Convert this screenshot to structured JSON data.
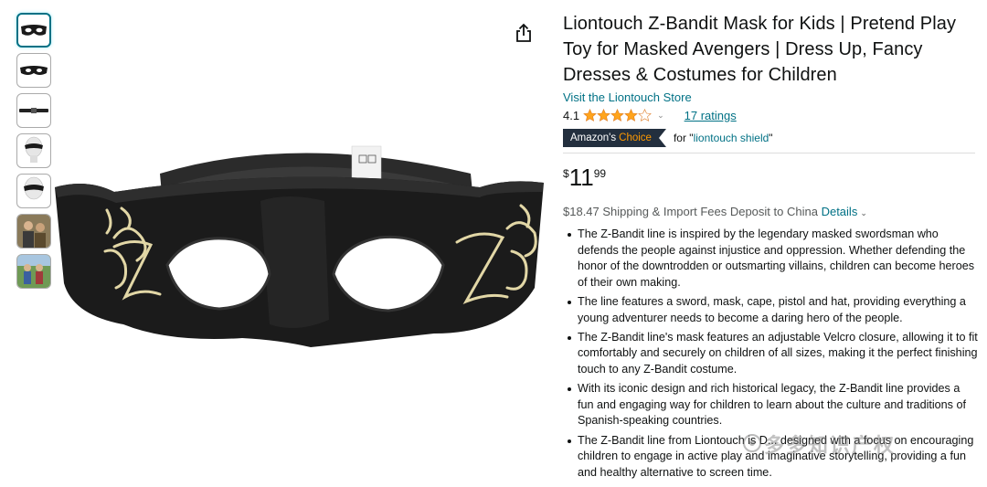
{
  "thumbnails": [
    {
      "icon": "mask-front-thumb"
    },
    {
      "icon": "mask-flat-thumb"
    },
    {
      "icon": "mask-strap-thumb"
    },
    {
      "icon": "mannequin-thumb"
    },
    {
      "icon": "mannequin-side-thumb"
    },
    {
      "icon": "kids-photo-thumb"
    },
    {
      "icon": "kids-outdoor-thumb"
    }
  ],
  "product": {
    "title": "Liontouch Z-Bandit Mask for Kids | Pretend Play Toy for Masked Avengers | Dress Up, Fancy Dresses & Costumes for Children",
    "store_link": "Visit the Liontouch Store",
    "rating": "4.1",
    "stars": 4.1,
    "ratings_count": "17 ratings",
    "badge_main": "Amazon's",
    "badge_choice": "Choice",
    "badge_for_prefix": "for \"",
    "badge_for_term": "liontouch shield",
    "badge_for_suffix": "\"",
    "price_symbol": "$",
    "price_whole": "11",
    "price_fraction": "99",
    "shipping_text": "$18.47 Shipping & Import Fees Deposit to China",
    "shipping_link": "Details",
    "bullets": [
      "The Z-Bandit line is inspired by the legendary masked swordsman who defends the people against injustice and oppression. Whether defending the honor of the downtrodden or outsmarting villains, children can become heroes of their own making.",
      "The line features a sword, mask, cape, pistol and hat, providing everything a young adventurer needs to become a daring hero of the people.",
      "The Z-Bandit line's mask features an adjustable Velcro closure, allowing it to fit comfortably and securely on children of all sizes, making it the perfect finishing touch to any Z-Bandit costume.",
      "With its iconic design and rich historical legacy, the Z-Bandit line provides a fun and engaging way for children to learn about the culture and traditions of Spanish-speaking countries.",
      "The Z-Bandit line from Liontouch is D... designed with a focus on encouraging children to engage in active play and imaginative storytelling, providing a fun and healthy alternative to screen time."
    ]
  },
  "watermark": "多多知识产权",
  "colors": {
    "link": "#007185",
    "badge_bg": "#232f3e",
    "badge_choice": "#ff9900",
    "star": "#ffa41c",
    "mask": "#1a1a1a",
    "embroidery": "#d9cfa3"
  }
}
